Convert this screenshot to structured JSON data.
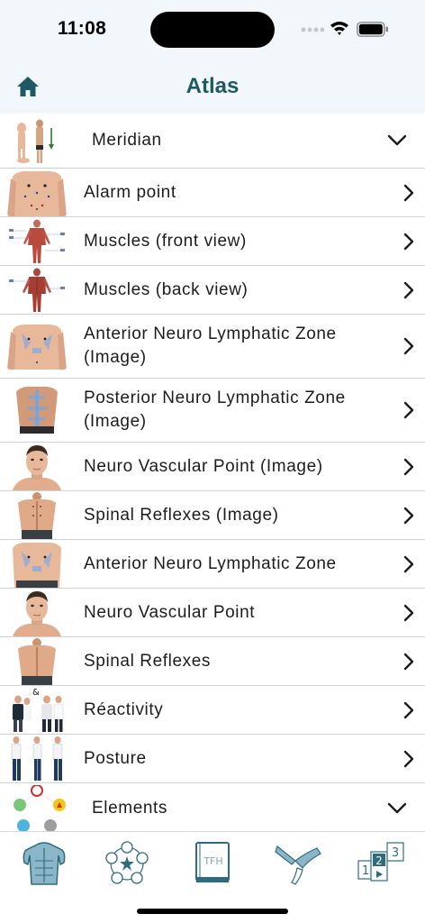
{
  "status": {
    "time": "11:08"
  },
  "nav": {
    "title": "Atlas",
    "home_icon": "home-icon"
  },
  "colors": {
    "accent": "#1f5a64",
    "skin": "#e8b89a",
    "divider": "#cfd3d6",
    "header_bg": "#f2f7fb"
  },
  "rows": [
    {
      "label": "Meridian",
      "kind": "section",
      "expanded": true,
      "thumb": "meridian-thumbnail"
    },
    {
      "label": "Alarm point",
      "kind": "item",
      "thumb": "torso-front-thumbnail"
    },
    {
      "label": "Muscles (front view)",
      "kind": "item",
      "thumb": "muscles-front-thumbnail"
    },
    {
      "label": "Muscles (back view)",
      "kind": "item",
      "thumb": "muscles-back-thumbnail"
    },
    {
      "label": "Anterior Neuro Lymphatic Zone (Image)",
      "kind": "item",
      "thumb": "torso-front-thumbnail"
    },
    {
      "label": "Posterior Neuro Lymphatic Zone (Image)",
      "kind": "item",
      "thumb": "torso-back-thumbnail"
    },
    {
      "label": "Neuro Vascular Point (Image)",
      "kind": "item",
      "thumb": "head-thumbnail"
    },
    {
      "label": "Spinal Reflexes (Image)",
      "kind": "item",
      "thumb": "torso-back-thumbnail"
    },
    {
      "label": "Anterior Neuro Lymphatic Zone",
      "kind": "item",
      "thumb": "torso-front-thumbnail"
    },
    {
      "label": "Neuro Vascular Point",
      "kind": "item",
      "thumb": "head-thumbnail"
    },
    {
      "label": "Spinal Reflexes",
      "kind": "item",
      "thumb": "torso-back-thumbnail"
    },
    {
      "label": "Réactivity",
      "kind": "item",
      "thumb": "reactivity-thumbnail",
      "thumb_text": "&"
    },
    {
      "label": "Posture",
      "kind": "item",
      "thumb": "posture-thumbnail"
    },
    {
      "label": "Elements",
      "kind": "section",
      "expanded": true,
      "thumb": "elements-thumbnail"
    }
  ],
  "tabs": [
    {
      "name": "tab-anatomy",
      "icon": "muscle-body-icon"
    },
    {
      "name": "tab-elements",
      "icon": "five-elements-icon"
    },
    {
      "name": "tab-book",
      "icon": "book-icon",
      "text": "TFH"
    },
    {
      "name": "tab-muscle-test",
      "icon": "muscle-test-icon"
    },
    {
      "name": "tab-sequence",
      "icon": "sequence-icon",
      "digits": [
        "1",
        "2",
        "3"
      ]
    }
  ]
}
